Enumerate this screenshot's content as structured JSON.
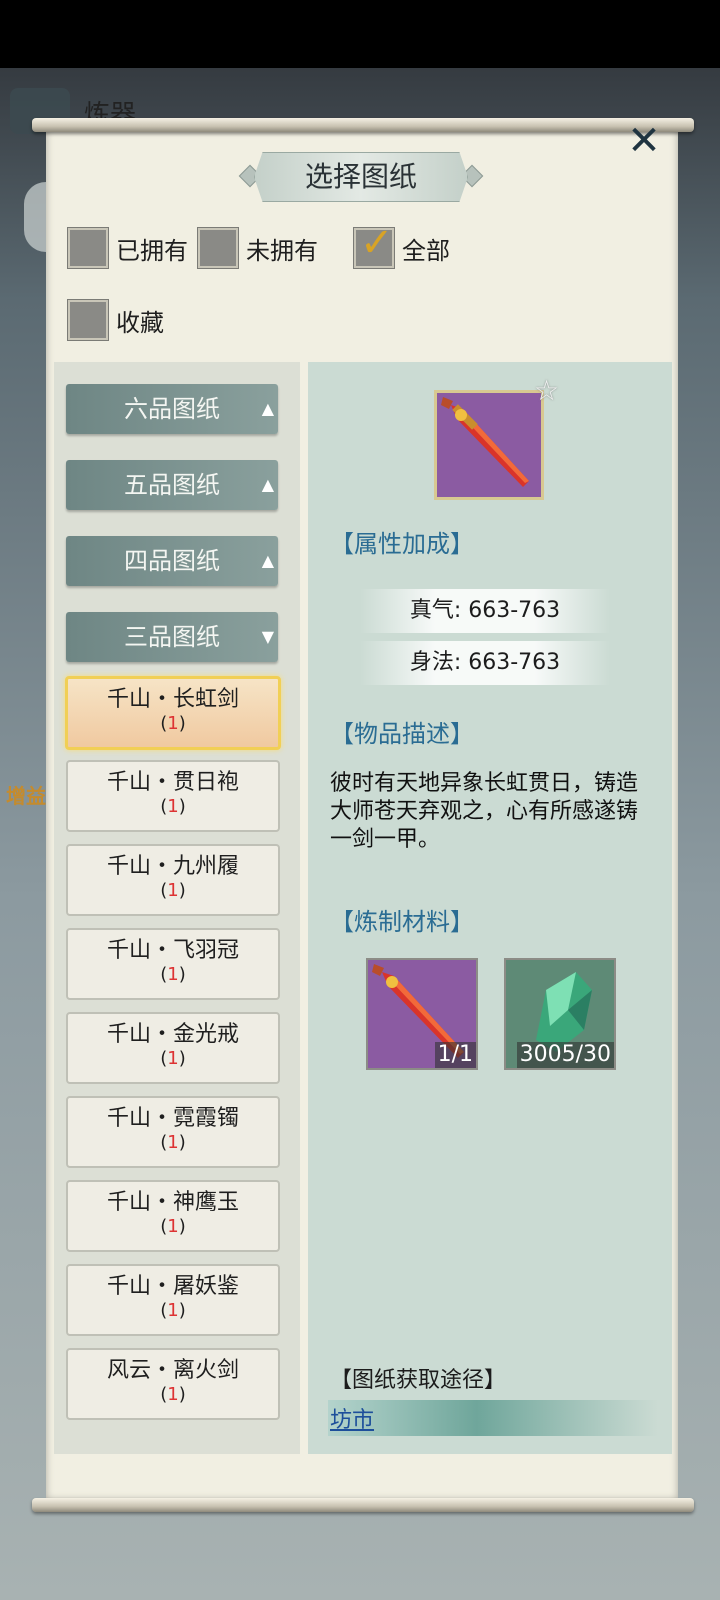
{
  "background": {
    "title": "炼器",
    "side_text": "增益"
  },
  "dialog": {
    "title": "选择图纸"
  },
  "filters": [
    {
      "label": "已拥有",
      "checked": false
    },
    {
      "label": "未拥有",
      "checked": false
    },
    {
      "label": "全部",
      "checked": true
    },
    {
      "label": "收藏",
      "checked": false
    }
  ],
  "categories": [
    {
      "label": "六品图纸",
      "arrow": "▲"
    },
    {
      "label": "五品图纸",
      "arrow": "▲"
    },
    {
      "label": "四品图纸",
      "arrow": "▲"
    },
    {
      "label": "三品图纸",
      "arrow": "▼"
    }
  ],
  "items": [
    {
      "name": "千山・长虹剑",
      "count": "1",
      "selected": true
    },
    {
      "name": "千山・贯日袍",
      "count": "1"
    },
    {
      "name": "千山・九州履",
      "count": "1"
    },
    {
      "name": "千山・飞羽冠",
      "count": "1"
    },
    {
      "name": "千山・金光戒",
      "count": "1"
    },
    {
      "name": "千山・霓霞镯",
      "count": "1"
    },
    {
      "name": "千山・神鹰玉",
      "count": "1"
    },
    {
      "name": "千山・屠妖鉴",
      "count": "1"
    },
    {
      "name": "风云・离火剑",
      "count": "1"
    }
  ],
  "detail": {
    "attr_title": "【属性加成】",
    "attributes": [
      "真气: 663-763",
      "身法: 663-763"
    ],
    "desc_title": "【物品描述】",
    "description": "彼时有天地异象长虹贯日，铸造大师苍天弃观之，心有所感遂铸一剑一甲。",
    "mat_title": "【炼制材料】",
    "materials": [
      {
        "icon": "sword-icon",
        "qty": "1/1"
      },
      {
        "icon": "jade-crystal-icon",
        "qty": "3005/30"
      }
    ],
    "acquire_title": "【图纸获取途径】",
    "acquire_link": "坊市"
  },
  "colors": {
    "accent_blue": "#2a6c93",
    "selected_border": "#f1cf55",
    "category_bg": "#7a9290"
  }
}
